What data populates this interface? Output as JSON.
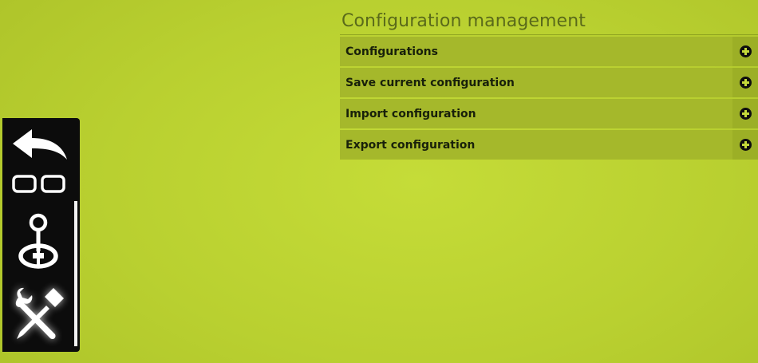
{
  "panel": {
    "title": "Configuration management",
    "items": [
      {
        "label": "Configurations"
      },
      {
        "label": "Save current configuration"
      },
      {
        "label": "Import configuration"
      },
      {
        "label": "Export configuration"
      }
    ]
  },
  "dock": {
    "items": [
      {
        "icon": "back-arrow-icon"
      },
      {
        "icon": "windows-icon"
      },
      {
        "icon": "joystick-icon"
      },
      {
        "icon": "tools-icon",
        "active": true
      }
    ]
  },
  "colors": {
    "background": "#b9d030",
    "menu_row": "#a5b82b",
    "dock": "#0c0c0c",
    "title_text": "#5a6a1a"
  }
}
